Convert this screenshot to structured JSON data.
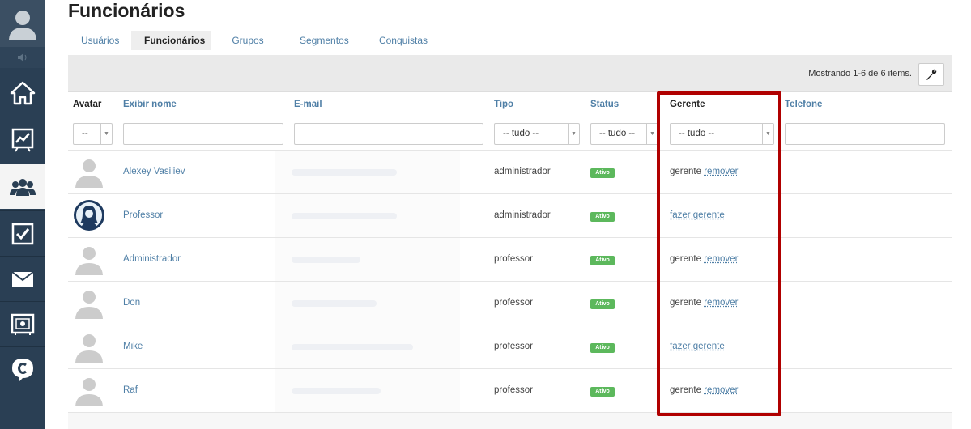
{
  "sidebar": {
    "items": [
      {
        "icon": "home-icon"
      },
      {
        "icon": "chart-icon"
      },
      {
        "icon": "users-icon",
        "active": true
      },
      {
        "icon": "checkbox-icon"
      },
      {
        "icon": "mail-icon"
      },
      {
        "icon": "safe-icon"
      },
      {
        "icon": "chat-icon"
      }
    ]
  },
  "page": {
    "title": "Funcionários",
    "tabs": [
      "Usuários",
      "Funcionários",
      "Grupos",
      "Segmentos",
      "Conquistas"
    ]
  },
  "summary": "Mostrando 1-6 de 6 items.",
  "columns": {
    "avatar": "Avatar",
    "name": "Exibir nome",
    "email": "E-mail",
    "type": "Tipo",
    "status": "Status",
    "manager": "Gerente",
    "phone": "Telefone"
  },
  "filters": {
    "avatar": "--",
    "type": "-- tudo --",
    "status": "-- tudo --",
    "manager": "-- tudo --"
  },
  "rows": [
    {
      "name": "Alexey Vasiliev",
      "type": "administrador",
      "status": "Ativo",
      "manager_text": "gerente",
      "manager_link": "remover"
    },
    {
      "name": "Professor",
      "type": "administrador",
      "status": "Ativo",
      "manager_text": "",
      "manager_link": "fazer gerente"
    },
    {
      "name": "Administrador",
      "type": "professor",
      "status": "Ativo",
      "manager_text": "gerente",
      "manager_link": "remover"
    },
    {
      "name": "Don",
      "type": "professor",
      "status": "Ativo",
      "manager_text": "gerente",
      "manager_link": "remover"
    },
    {
      "name": "Mike",
      "type": "professor",
      "status": "Ativo",
      "manager_text": "",
      "manager_link": "fazer gerente"
    },
    {
      "name": "Raf",
      "type": "professor",
      "status": "Ativo",
      "manager_text": "gerente",
      "manager_link": "remover"
    }
  ],
  "colors": {
    "sidebar": "#2a3f54",
    "link": "#4f7fa6",
    "badge": "#5cb85c",
    "highlight": "#b00000"
  }
}
